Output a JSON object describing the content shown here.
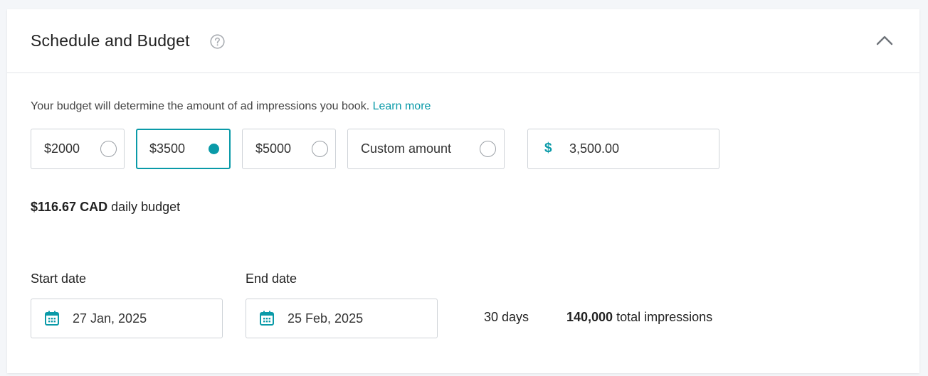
{
  "section": {
    "title": "Schedule and Budget",
    "help_icon": "question-circle-icon",
    "collapse_icon": "chevron-up-icon"
  },
  "budget": {
    "intro_text": "Your budget will determine the amount of ad impressions you book.",
    "learn_more": "Learn more",
    "options": [
      {
        "label": "$2000",
        "selected": false
      },
      {
        "label": "$3500",
        "selected": true
      },
      {
        "label": "$5000",
        "selected": false
      },
      {
        "label": "Custom amount",
        "selected": false
      }
    ],
    "currency_symbol": "$",
    "amount_value": "3,500.00",
    "daily_amount": "$116.67 CAD",
    "daily_suffix": "daily budget"
  },
  "schedule": {
    "start_label": "Start date",
    "start_value": "27 Jan, 2025",
    "end_label": "End date",
    "end_value": "25 Feb, 2025",
    "calendar_icon": "calendar-icon",
    "duration": "30 days",
    "impressions_count": "140,000",
    "impressions_suffix": "total impressions"
  },
  "colors": {
    "accent": "#0a9aa8",
    "border": "#cfd3d8",
    "text": "#222222"
  }
}
